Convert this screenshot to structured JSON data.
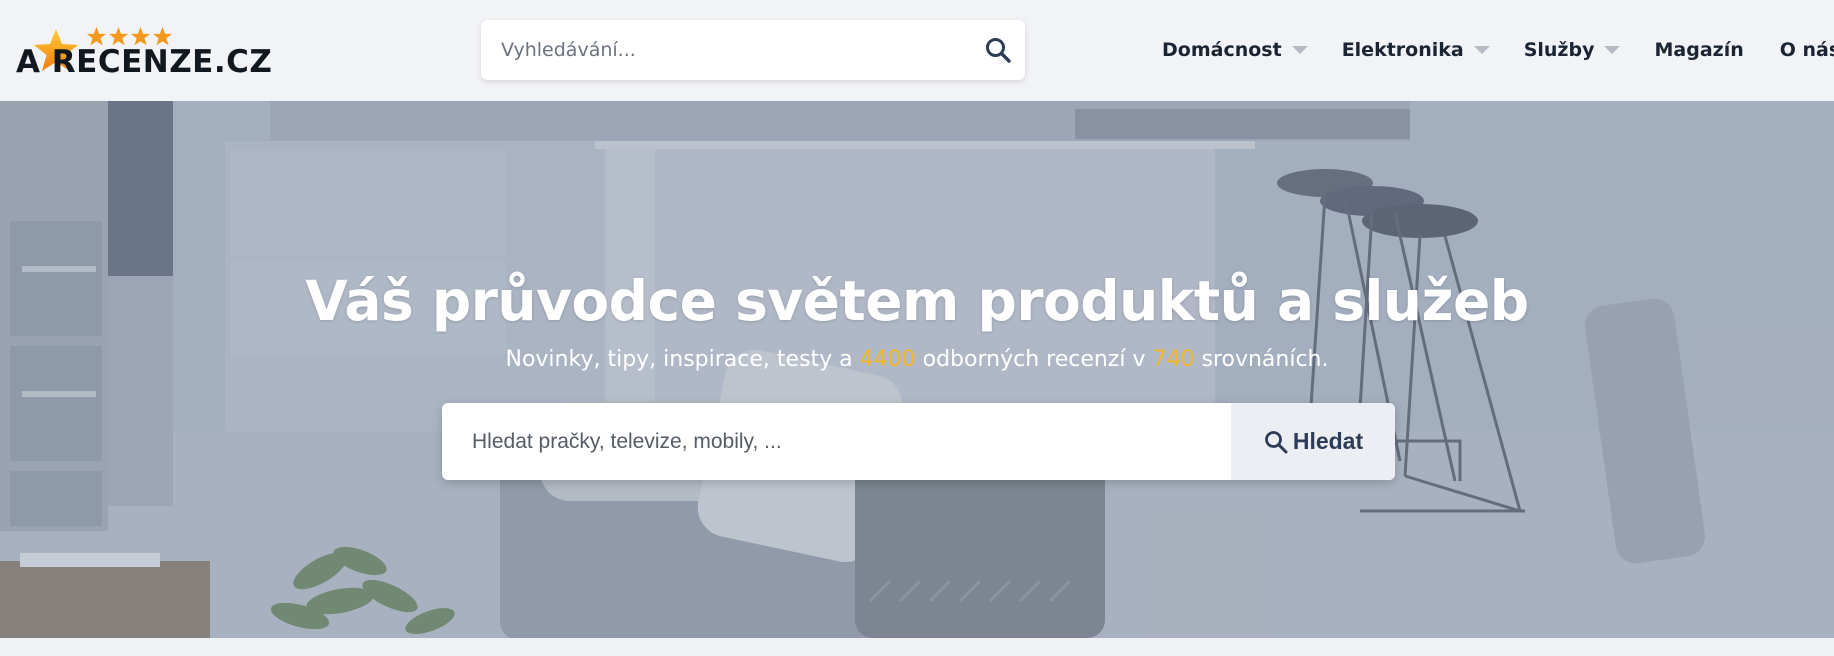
{
  "header": {
    "logo": {
      "text": "A RECENZE.CZ"
    },
    "search": {
      "placeholder": "Vyhledávání..."
    },
    "nav": [
      {
        "label": "Domácnost",
        "has_dropdown": true
      },
      {
        "label": "Elektronika",
        "has_dropdown": true
      },
      {
        "label": "Služby",
        "has_dropdown": true
      },
      {
        "label": "Magazín",
        "has_dropdown": false
      },
      {
        "label": "O nás",
        "has_dropdown": false
      }
    ]
  },
  "hero": {
    "title": "Váš průvodce světem produktů a služeb",
    "subtitle": {
      "part1": "Novinky, tipy, inspirace, testy a ",
      "reviews_count": "4400",
      "part2": " odborných recenzí v ",
      "comparisons_count": "740",
      "part3": " srovnáních."
    },
    "search": {
      "placeholder": "Hledat pračky, televize, mobily, ...",
      "button_label": "Hledat"
    }
  },
  "colors": {
    "accent": "#f5b825",
    "star_orange": "#f39a1e",
    "nav_text": "#1b2433",
    "button_text": "#2c3b57",
    "header_bg": "#f2f3f6"
  },
  "icons": {
    "top_search": "search-icon",
    "hero_search": "search-icon",
    "nav_dropdown": "chevron-down-icon",
    "logo_stars": "star-icon"
  }
}
